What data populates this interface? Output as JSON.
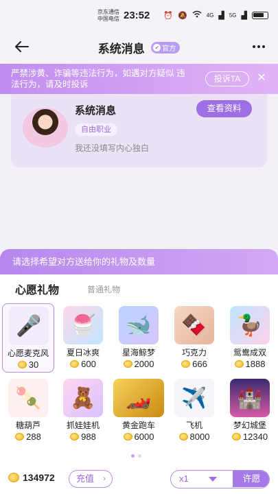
{
  "status_bar": {
    "carrier_1": "京东通信",
    "carrier_2": "中国电信",
    "time": "23:52",
    "network_1": "4G",
    "network_2": "5G"
  },
  "header": {
    "title": "系统消息",
    "badge": "官方"
  },
  "warning": {
    "text": "严禁涉黄、诈骗等违法行为，如遇对方疑似 违法行为，请及时投诉",
    "report_label": "投诉TA",
    "close": "✕"
  },
  "profile": {
    "name": "系统消息",
    "tag": "自由职业",
    "bio": "我还没填写内心独白",
    "view_button": "查看资料"
  },
  "gift_panel": {
    "prompt": "请选择希望对方送给你的礼物及数量",
    "tabs": [
      "心愿礼物",
      "普通礼物"
    ],
    "gifts": [
      {
        "name": "心愿麦克风",
        "price": "30",
        "icon": "microphone-icon",
        "selected": true
      },
      {
        "name": "夏日冰爽",
        "price": "600",
        "icon": "ice-cream-icon"
      },
      {
        "name": "星海鲸梦",
        "price": "2000",
        "icon": "whale-icon"
      },
      {
        "name": "巧克力",
        "price": "666",
        "icon": "chocolate-icon"
      },
      {
        "name": "鸳鸯成双",
        "price": "1888",
        "icon": "ducks-icon"
      },
      {
        "name": "糖葫芦",
        "price": "288",
        "icon": "candied-haws-icon"
      },
      {
        "name": "抓娃娃机",
        "price": "988",
        "icon": "claw-machine-icon"
      },
      {
        "name": "黄金跑车",
        "price": "6000",
        "icon": "sports-car-icon"
      },
      {
        "name": "飞机",
        "price": "8000",
        "icon": "airplane-icon"
      },
      {
        "name": "梦幻城堡",
        "price": "12340",
        "icon": "castle-icon"
      }
    ],
    "page": 1,
    "pages": 2
  },
  "bottom": {
    "balance": "134972",
    "recharge_label": "充值",
    "quantity": "x1",
    "wish_label": "许愿"
  },
  "colors": {
    "accent": "#9e6fe4",
    "banner": "#c08ef0"
  }
}
